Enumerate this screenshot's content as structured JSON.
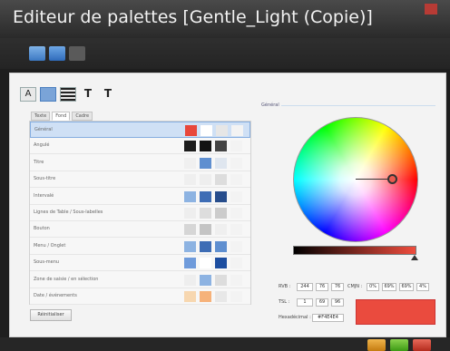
{
  "window": {
    "title": "Editeur de palettes [Gentle_Light (Copie)]"
  },
  "toolbar": {
    "buttons": [
      "display-icon",
      "undo-icon",
      "grid-icon"
    ]
  },
  "format_bar": {
    "items": [
      "A",
      "",
      "",
      "T",
      "T"
    ]
  },
  "tabs": [
    "Texte",
    "Fond",
    "Cadre"
  ],
  "rows": [
    {
      "label": "Général",
      "colors": [
        "#e8473b",
        "#ffffff",
        "#e6e6e6",
        "#f3f3f3"
      ]
    },
    {
      "label": "Angulé",
      "colors": [
        "#1c1c1c",
        "#121212",
        "#444444",
        "#f3f3f3"
      ]
    },
    {
      "label": "Titre",
      "colors": [
        "#f0f0f0",
        "#5f8fd0",
        "#dfe6ef",
        "#f3f3f3"
      ]
    },
    {
      "label": "Sous-titre",
      "colors": [
        "#efefef",
        "#eeeeee",
        "#dddddd",
        "#f3f3f3"
      ]
    },
    {
      "label": "Intervalé",
      "colors": [
        "#8db3e2",
        "#3e6db5",
        "#274d8c",
        "#f3f3f3"
      ]
    },
    {
      "label": "Lignes de Table / Sous-labelles",
      "colors": [
        "#eeeeee",
        "#dddddd",
        "#cccccc",
        "#f3f3f3"
      ]
    },
    {
      "label": "Bouton",
      "colors": [
        "#d6d6d6",
        "#c4c4c4",
        "#efefef",
        "#f3f3f3"
      ]
    },
    {
      "label": "Menu / Onglet",
      "colors": [
        "#8db3e2",
        "#3e6db5",
        "#5f8fd0",
        "#f3f3f3"
      ]
    },
    {
      "label": "Sous-menu",
      "colors": [
        "#6f9bdb",
        "#ffffff",
        "#1d4ea0",
        "#f3f3f3"
      ]
    },
    {
      "label": "Zone de saisie / en sélection",
      "colors": [
        "#eeeeee",
        "#8db3e2",
        "#dddddd",
        "#f3f3f3"
      ]
    },
    {
      "label": "Date / événements",
      "colors": [
        "#f7d7b0",
        "#f6b27a",
        "#e8e8e8",
        "#f3f3f3"
      ]
    }
  ],
  "reset_button": "Réinitialiser",
  "group_label": "Général",
  "fields": {
    "rgb_label": "RVB :",
    "rgb": [
      "244",
      "76",
      "76"
    ],
    "cmjn_label": "CMJN :",
    "cmjn": [
      "0%",
      "69%",
      "69%",
      "4%"
    ],
    "tsl_label": "TSL :",
    "tsl": [
      "1",
      "69",
      "96"
    ],
    "hex_label": "Hexadécimal :",
    "hex": "#F4E4E4"
  },
  "colors": {
    "accent": "#ea4b3e",
    "selection": "#cfe0f5"
  },
  "bottom_buttons": [
    "back-icon",
    "ok-icon",
    "cancel-icon"
  ]
}
